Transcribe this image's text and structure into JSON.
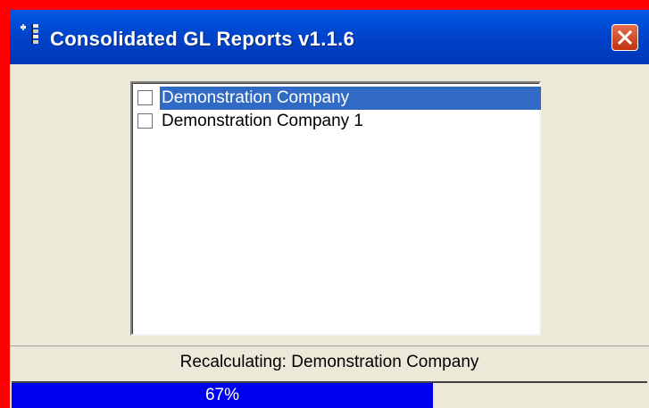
{
  "window": {
    "title": "Consolidated GL Reports v1.1.6"
  },
  "companies": {
    "items": [
      {
        "label": "Demonstration Company",
        "checked": false,
        "selected": true
      },
      {
        "label": "Demonstration Company 1",
        "checked": false,
        "selected": false
      }
    ]
  },
  "status": {
    "text": "Recalculating: Demonstration Company"
  },
  "progress": {
    "value": 0.67,
    "label": "67%"
  },
  "colors": {
    "titlebar": "#0041c8",
    "selection": "#316ac5",
    "progress_fill": "#0000f0",
    "border": "#ff0000"
  }
}
